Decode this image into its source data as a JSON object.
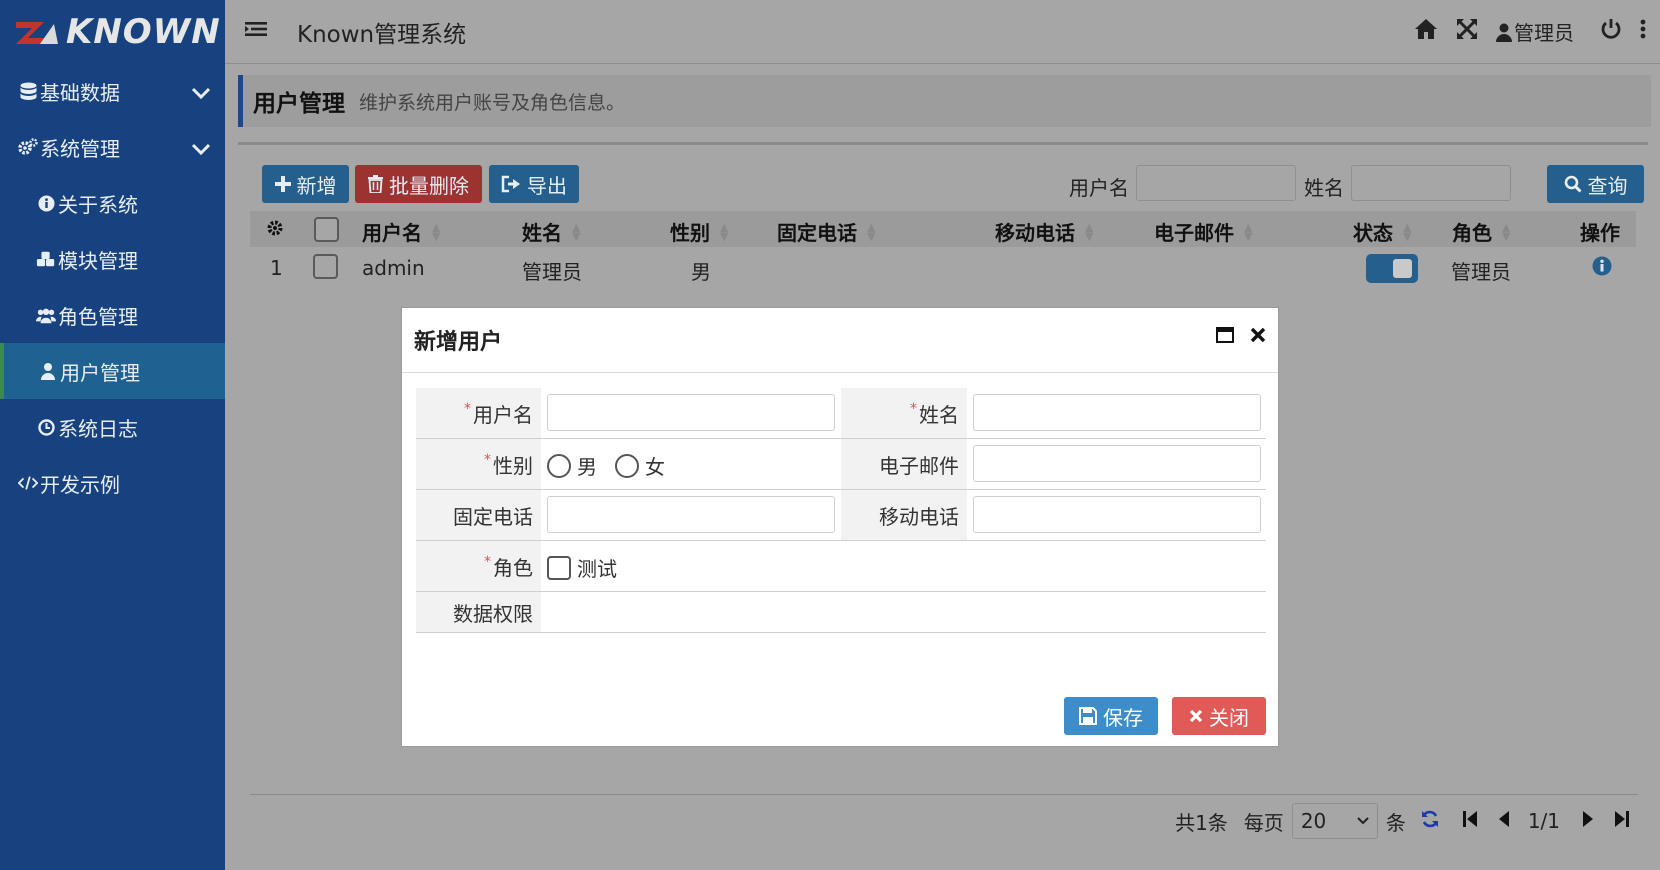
{
  "app": {
    "logo": "KNOWN",
    "title": "Known管理系统",
    "user": "管理员"
  },
  "sidebar": {
    "items": [
      {
        "label": "基础数据",
        "icon": "database-icon"
      },
      {
        "label": "系统管理",
        "icon": "cogs-icon"
      },
      {
        "label": "关于系统",
        "icon": "info-circle-icon"
      },
      {
        "label": "模块管理",
        "icon": "cubes-icon"
      },
      {
        "label": "角色管理",
        "icon": "users-icon"
      },
      {
        "label": "用户管理",
        "icon": "user-icon"
      },
      {
        "label": "系统日志",
        "icon": "clock-icon"
      },
      {
        "label": "开发示例",
        "icon": "code-icon"
      }
    ]
  },
  "page": {
    "title": "用户管理",
    "description": "维护系统用户账号及角色信息。"
  },
  "toolbar": {
    "add": "新增",
    "batch_delete": "批量删除",
    "export": "导出",
    "username_label": "用户名",
    "name_label": "姓名",
    "query": "查询"
  },
  "table": {
    "columns": [
      "用户名",
      "姓名",
      "性别",
      "固定电话",
      "移动电话",
      "电子邮件",
      "状态",
      "角色",
      "操作"
    ],
    "rows": [
      {
        "index": "1",
        "username": "admin",
        "name": "管理员",
        "gender": "男",
        "phone": "",
        "mobile": "",
        "email": "",
        "status_enabled": true,
        "role": "管理员"
      }
    ]
  },
  "pager": {
    "total": "共1条",
    "per_page_label": "每页",
    "per_page": "20",
    "unit": "条",
    "page": "1/1"
  },
  "modal": {
    "title": "新增用户",
    "fields": {
      "username": "用户名",
      "name": "姓名",
      "gender": "性别",
      "email": "电子邮件",
      "phone": "固定电话",
      "mobile": "移动电话",
      "role": "角色",
      "data_scope": "数据权限"
    },
    "gender_options": [
      "男",
      "女"
    ],
    "role_options": [
      "测试"
    ],
    "required_mark": "*",
    "save": "保存",
    "close": "关闭"
  }
}
